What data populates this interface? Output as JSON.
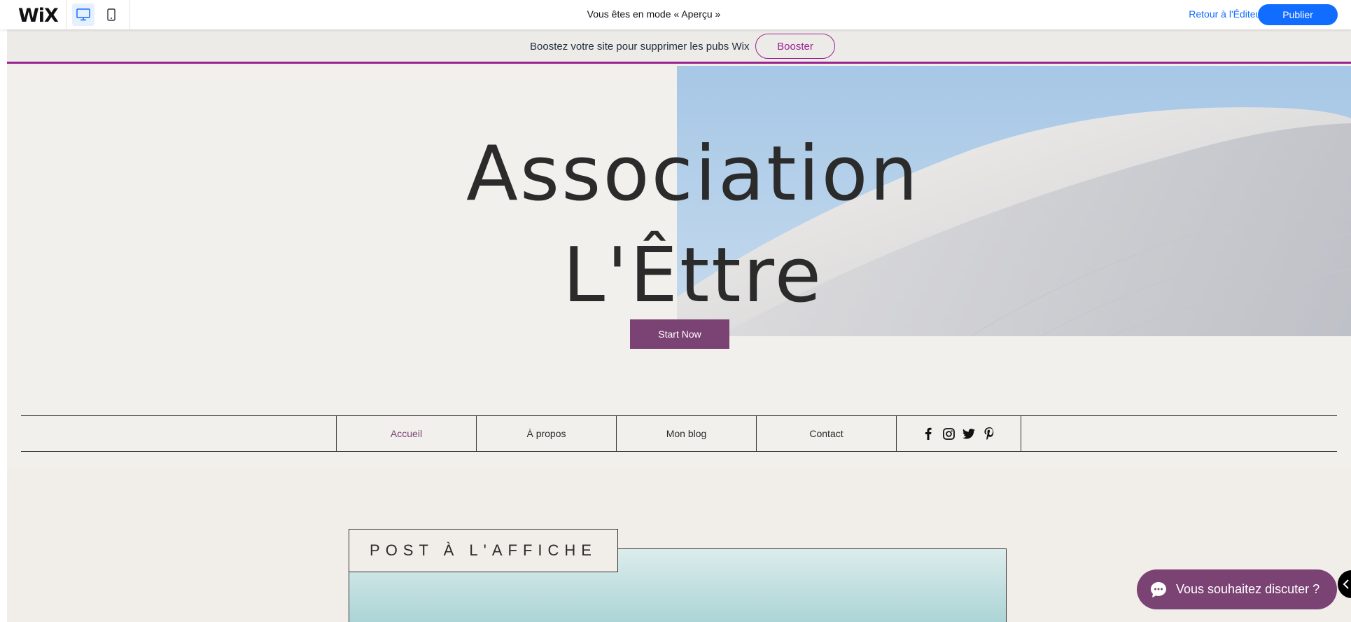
{
  "topbar": {
    "logo": "WiX",
    "preview_label": "Vous êtes en mode « Aperçu »",
    "back_to_editor": "Retour à l'Éditeur",
    "publish": "Publier"
  },
  "banner": {
    "text": "Boostez votre site pour supprimer les pubs Wix",
    "button": "Booster"
  },
  "hero": {
    "title_line1": "Association",
    "title_line2": "L'Êttre",
    "cta": "Start Now"
  },
  "nav": {
    "items": [
      {
        "label": "Accueil",
        "active": true
      },
      {
        "label": "À propos",
        "active": false
      },
      {
        "label": "Mon blog",
        "active": false
      },
      {
        "label": "Contact",
        "active": false
      }
    ],
    "social": [
      "facebook-icon",
      "instagram-icon",
      "twitter-icon",
      "pinterest-icon"
    ]
  },
  "featured": {
    "label": "POST À L'AFFICHE"
  },
  "chat": {
    "label": "Vous souhaitez discuter ?"
  },
  "colors": {
    "accent": "#7b4373",
    "wix_blue": "#116dff",
    "banner_border": "#9a2391",
    "background": "#f1eeea"
  }
}
